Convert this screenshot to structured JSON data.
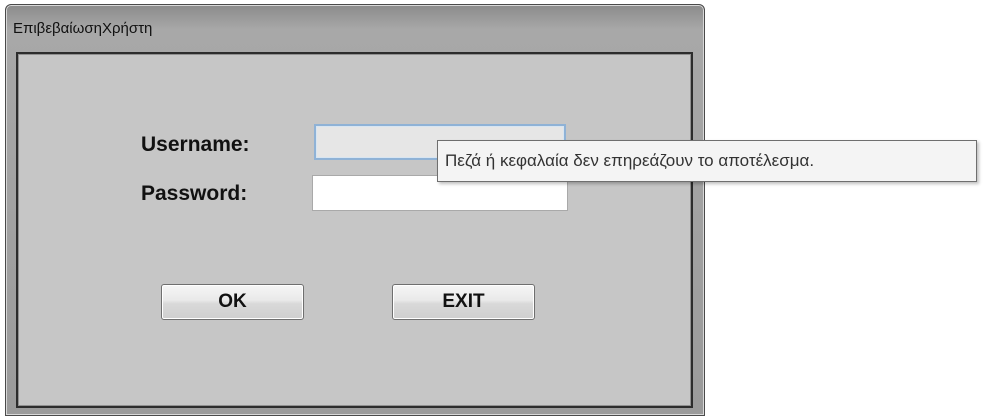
{
  "window": {
    "title": "ΕπιβεβαίωσηΧρήστη"
  },
  "form": {
    "username_label": "Username:",
    "password_label": "Password:",
    "username_value": "",
    "password_value": ""
  },
  "buttons": {
    "ok_label": "OK",
    "exit_label": "EXIT"
  },
  "tooltip": {
    "text": "Πεζά ή κεφαλαία δεν επηρεάζουν το αποτέλεσμα."
  },
  "colors": {
    "client_background": "#c6c6c6",
    "titlebar": "#9a9a9a",
    "tooltip_background": "#f4f4f4",
    "focus_border": "#8fb2d6"
  }
}
